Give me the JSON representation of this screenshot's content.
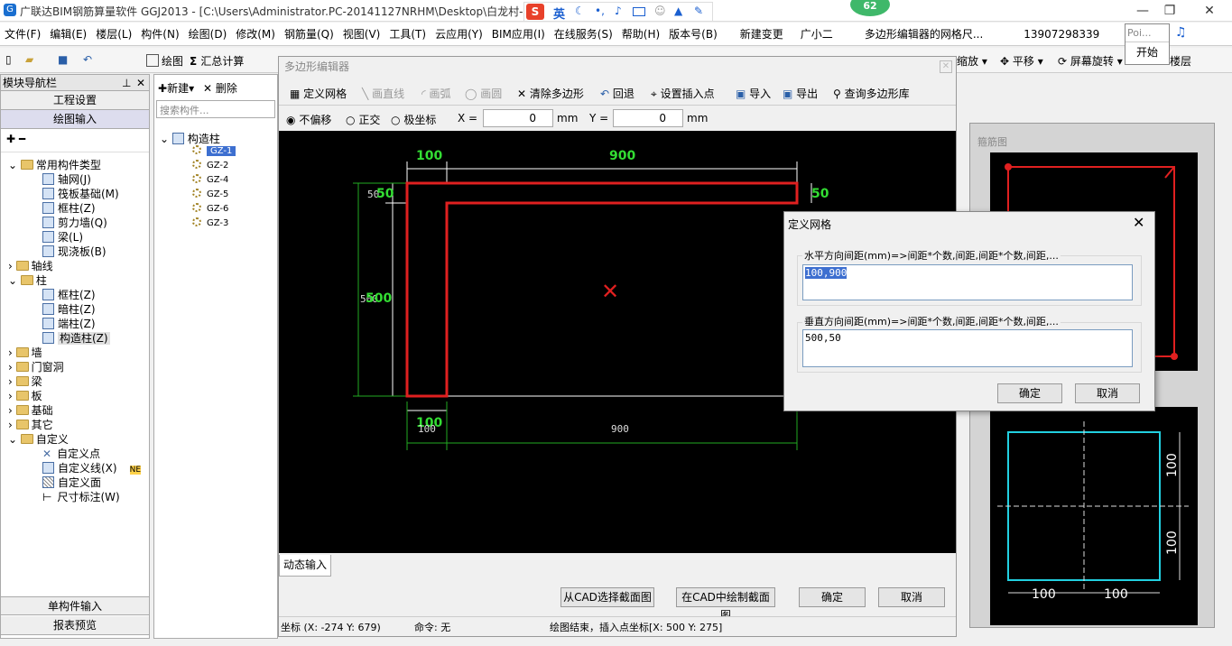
{
  "window": {
    "title": "广联达BIM钢筋算量软件 GGJ2013 - [C:\\Users\\Administrator.PC-20141127NRHM\\Desktop\\白龙村-",
    "title_tail": "]",
    "badge": "62"
  },
  "ime": {
    "lang": "英"
  },
  "menu": [
    "文件(F)",
    "编辑(E)",
    "楼层(L)",
    "构件(N)",
    "绘图(D)",
    "修改(M)",
    "钢筋量(Q)",
    "视图(V)",
    "工具(T)",
    "云应用(Y)",
    "BIM应用(I)",
    "在线服务(S)",
    "帮助(H)",
    "版本号(B)",
    "新建变更",
    "广小二",
    "多边形编辑器的网格尺...",
    "13907298339"
  ],
  "toolbar": {
    "draw": "绘图",
    "sum": "汇总计算",
    "zoom": "缩放",
    "pan": "平移",
    "rotate": "屏幕旋转",
    "floor": "楼层"
  },
  "popup": {
    "input": "Poi...",
    "start": "开始"
  },
  "nav": {
    "title": "模块导航栏",
    "project": "工程设置",
    "draw_input": "绘图输入",
    "single": "单构件输入",
    "report": "报表预览",
    "tree": [
      "常用构件类型",
      "轴网(J)",
      "筏板基础(M)",
      "框柱(Z)",
      "剪力墙(Q)",
      "梁(L)",
      "现浇板(B)",
      "轴线",
      "柱",
      "框柱(Z)",
      "暗柱(Z)",
      "端柱(Z)",
      "构造柱(Z)",
      "墙",
      "门窗洞",
      "梁",
      "板",
      "基础",
      "其它",
      "自定义",
      "自定义点",
      "自定义线(X)",
      "自定义面",
      "尺寸标注(W)"
    ],
    "ne": "NE"
  },
  "list": {
    "new": "新建",
    "delete": "删除",
    "search": "搜索构件...",
    "root": "构造柱",
    "items": [
      "GZ-1",
      "GZ-2",
      "GZ-4",
      "GZ-5",
      "GZ-6",
      "GZ-3"
    ]
  },
  "poly": {
    "title": "多边形编辑器",
    "tools": [
      "定义网格",
      "画直线",
      "画弧",
      "画圆",
      "清除多边形",
      "回退",
      "设置插入点",
      "导入",
      "导出",
      "查询多边形库"
    ],
    "opts": {
      "no_offset": "不偏移",
      "ortho": "正交",
      "polar": "极坐标",
      "x_label": "X =",
      "x_val": "0",
      "y_label": "Y =",
      "y_val": "0",
      "unit": "mm"
    },
    "dims": {
      "top_left": "100",
      "top_right": "900",
      "left_top": "50",
      "right_top": "50",
      "left_side": "500",
      "bottom": "100",
      "bottom_small": "100",
      "bottom_right": "900"
    },
    "dyn": "动态输入",
    "btn_cad_select": "从CAD选择截面图",
    "btn_cad_draw": "在CAD中绘制截面图",
    "ok": "确定",
    "cancel": "取消",
    "status": {
      "coord": "坐标 (X: -274 Y: 679)",
      "cmd": "命令: 无",
      "msg": "绘图结束，插入点坐标[X: 500 Y: 275]"
    }
  },
  "grid": {
    "title": "定义网格",
    "h_label": "水平方向间距(mm)=>间距*个数,间距,间距*个数,间距,...",
    "h_val": "100,900",
    "v_label": "垂直方向间距(mm)=>间距*个数,间距,间距*个数,间距,...",
    "v_val": "500,50",
    "ok": "确定",
    "cancel": "取消"
  },
  "right": {
    "title": "箍筋图",
    "dim1": "100",
    "dim2": "100",
    "dim3": "100",
    "dim4": "100"
  }
}
